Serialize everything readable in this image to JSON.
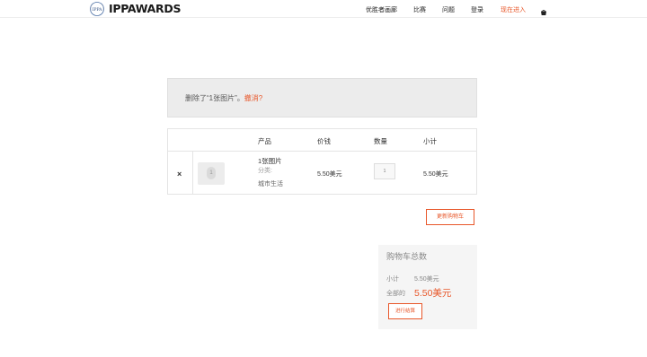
{
  "brand": {
    "name": "IPPAWARDS",
    "emblem_text": "IPPA"
  },
  "nav": {
    "items": [
      {
        "label": "优胜者画廊",
        "active": false
      },
      {
        "label": "比赛",
        "active": false
      },
      {
        "label": "问题",
        "active": false
      },
      {
        "label": "登录",
        "active": false
      },
      {
        "label": "现在进入",
        "active": true
      }
    ],
    "cart_icon": "basket-icon"
  },
  "notice": {
    "message": "删除了“1张图片”。",
    "undo_label": "撤消?"
  },
  "cart": {
    "headers": {
      "product": "产品",
      "price": "价钱",
      "quantity": "数量",
      "subtotal": "小计"
    },
    "row": {
      "remove_label": "×",
      "thumb_text": "1",
      "name": "1张图片",
      "meta": "分类:",
      "category": "城市生活",
      "price": "5.50美元",
      "quantity": "1",
      "subtotal": "5.50美元"
    },
    "update_label": "更新购物车"
  },
  "totals": {
    "title": "购物车总数",
    "subtotal_label": "小计",
    "subtotal_value": "5.50美元",
    "total_label": "全部的",
    "total_value": "5.50美元",
    "checkout_label": "进行结算"
  },
  "colors": {
    "accent": "#e8572a",
    "notice_bg": "#ececec",
    "totals_bg": "#f5f5f5"
  }
}
